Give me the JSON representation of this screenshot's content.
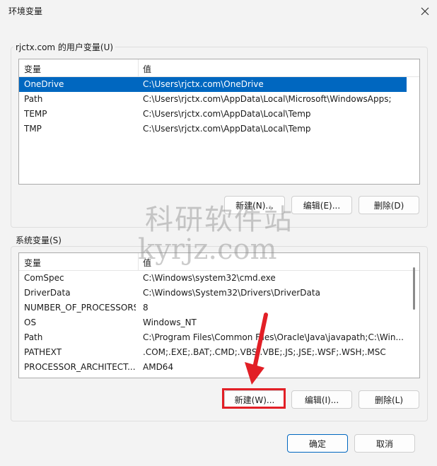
{
  "window": {
    "title": "环境变量"
  },
  "user_section": {
    "label": "rjctx.com 的用户变量(U)",
    "columns": [
      "变量",
      "值"
    ],
    "rows": [
      {
        "name": "OneDrive",
        "value": "C:\\Users\\rjctx.com\\OneDrive"
      },
      {
        "name": "Path",
        "value": "C:\\Users\\rjctx.com\\AppData\\Local\\Microsoft\\WindowsApps;"
      },
      {
        "name": "TEMP",
        "value": "C:\\Users\\rjctx.com\\AppData\\Local\\Temp"
      },
      {
        "name": "TMP",
        "value": "C:\\Users\\rjctx.com\\AppData\\Local\\Temp"
      }
    ],
    "buttons": {
      "new": "新建(N)...",
      "edit": "编辑(E)...",
      "delete": "删除(D)"
    }
  },
  "system_section": {
    "label": "系统变量(S)",
    "columns": [
      "变量",
      "值"
    ],
    "rows": [
      {
        "name": "ComSpec",
        "value": "C:\\Windows\\system32\\cmd.exe"
      },
      {
        "name": "DriverData",
        "value": "C:\\Windows\\System32\\Drivers\\DriverData"
      },
      {
        "name": "NUMBER_OF_PROCESSORS",
        "value": "8"
      },
      {
        "name": "OS",
        "value": "Windows_NT"
      },
      {
        "name": "Path",
        "value": "C:\\Program Files\\Common Files\\Oracle\\Java\\javapath;C:\\Win..."
      },
      {
        "name": "PATHEXT",
        "value": ".COM;.EXE;.BAT;.CMD;.VBS;.VBE;.JS;.JSE;.WSF;.WSH;.MSC"
      },
      {
        "name": "PROCESSOR_ARCHITECT...",
        "value": "AMD64"
      }
    ],
    "buttons": {
      "new": "新建(W)...",
      "edit": "编辑(I)...",
      "delete": "删除(L)"
    }
  },
  "footer": {
    "ok": "确定",
    "cancel": "取消"
  },
  "watermark": {
    "line1": "科研软件站",
    "line2": "kyrjz.com"
  },
  "colors": {
    "selection": "#0067c0",
    "highlight": "#e21f26"
  }
}
